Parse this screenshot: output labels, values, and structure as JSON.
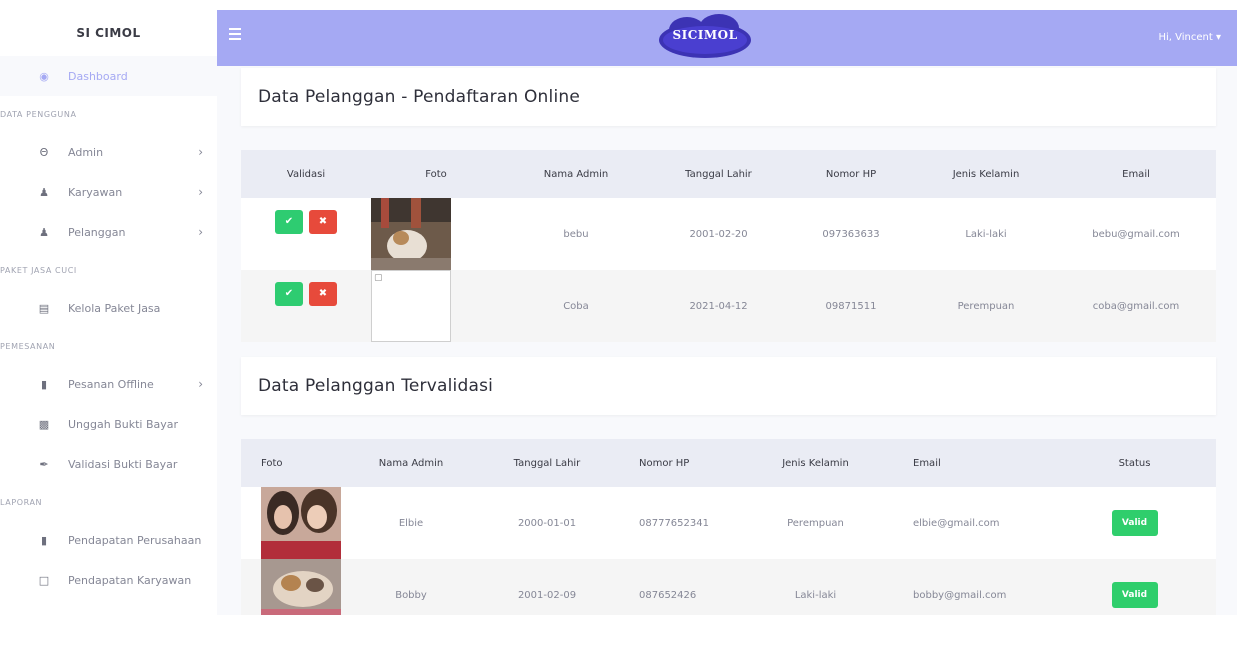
{
  "sidebar": {
    "brand": "SI CIMOL",
    "dashboard": "Dashboard",
    "heading_pengguna": "DATA PENGGUNA",
    "admin": "Admin",
    "karyawan": "Karyawan",
    "pelanggan": "Pelanggan",
    "heading_paket": "PAKET JASA CUCI",
    "kelola": "Kelola Paket Jasa",
    "heading_pemesanan": "PEMESANAN",
    "pesanan_offline": "Pesanan Offline",
    "unggah": "Unggah Bukti Bayar",
    "validasi": "Validasi Bukti Bayar",
    "heading_laporan": "LAPORAN",
    "pendapatan_perusahaan": "Pendapatan Perusahaan",
    "pendapatan_karyawan": "Pendapatan Karyawan"
  },
  "topbar": {
    "logo_text": "SICIMOL",
    "user": "Hi, Vincent ▾"
  },
  "online": {
    "title": "Data Pelanggan - Pendaftaran Online",
    "headers": [
      "Validasi",
      "Foto",
      "Nama Admin",
      "Tanggal Lahir",
      "Nomor HP",
      "Jenis Kelamin",
      "Email"
    ],
    "rows": [
      {
        "nama": "bebu",
        "tanggal": "2001-02-20",
        "hp": "097363633",
        "jk": "Laki-laki",
        "email": "bebu@gmail.com"
      },
      {
        "nama": "Coba",
        "tanggal": "2021-04-12",
        "hp": "09871511",
        "jk": "Perempuan",
        "email": "coba@gmail.com"
      }
    ],
    "ok_symbol": "✔",
    "x_symbol": "✖"
  },
  "validated": {
    "title": "Data Pelanggan Tervalidasi",
    "headers": [
      "Foto",
      "Nama Admin",
      "Tanggal Lahir",
      "Nomor HP",
      "Jenis Kelamin",
      "Email",
      "Status"
    ],
    "rows": [
      {
        "nama": "Elbie",
        "tanggal": "2000-01-01",
        "hp": "08777652341",
        "jk": "Perempuan",
        "email": "elbie@gmail.com",
        "status": "Valid"
      },
      {
        "nama": "Bobby",
        "tanggal": "2001-02-09",
        "hp": "087652426",
        "jk": "Laki-laki",
        "email": "bobby@gmail.com",
        "status": "Valid"
      }
    ]
  },
  "colors": {
    "primary": "#a5a9f3",
    "success": "#2ecc71",
    "danger": "#e74a3b"
  }
}
